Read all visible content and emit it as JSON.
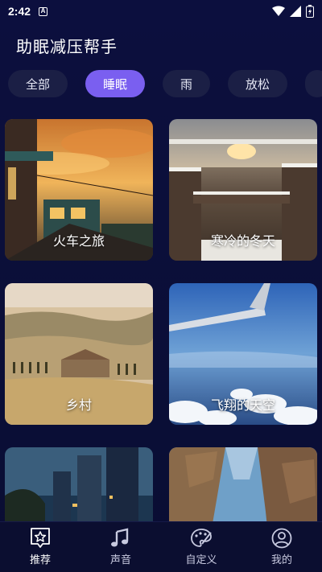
{
  "status": {
    "time": "2:42",
    "notice": "A"
  },
  "app": {
    "title": "助眠减压帮手"
  },
  "tabs": [
    {
      "label": "全部",
      "active": false
    },
    {
      "label": "睡眠",
      "active": true
    },
    {
      "label": "雨",
      "active": false
    },
    {
      "label": "放松",
      "active": false
    }
  ],
  "cards": [
    {
      "label": "火车之旅"
    },
    {
      "label": "寒冷的冬天"
    },
    {
      "label": "乡村"
    },
    {
      "label": "飞翔的天空"
    },
    {
      "label": ""
    },
    {
      "label": ""
    }
  ],
  "nav": [
    {
      "label": "推荐",
      "icon": "star-frame-icon",
      "active": true
    },
    {
      "label": "声音",
      "icon": "music-note-icon",
      "active": false
    },
    {
      "label": "自定义",
      "icon": "palette-icon",
      "active": false
    },
    {
      "label": "我的",
      "icon": "user-icon",
      "active": false
    }
  ],
  "colors": {
    "accent": "#7a5ff0",
    "background": "#0c0f3e",
    "tab_bg": "#1b1f45"
  }
}
